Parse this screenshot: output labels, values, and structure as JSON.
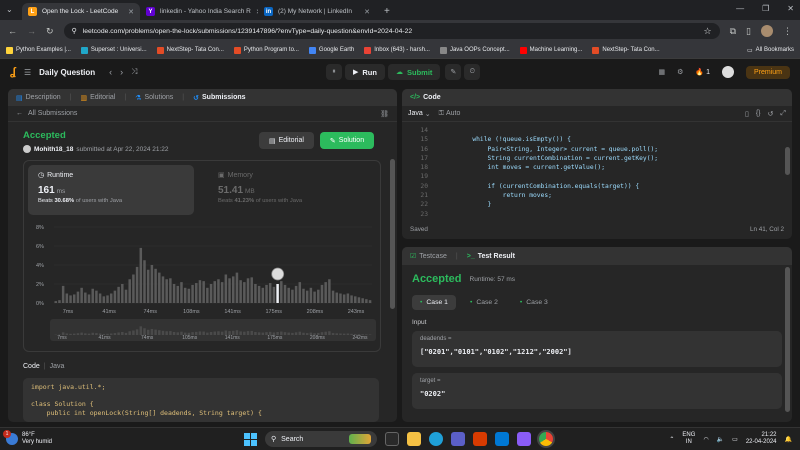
{
  "browser": {
    "tabs": [
      {
        "title": "Open the Lock - LeetCode",
        "active": true,
        "fav_color": "#ffa116",
        "fav_glyph": "L"
      },
      {
        "title": "linkedin - Yahoo India Search R",
        "active": false,
        "fav_color": "#6001d2",
        "fav_glyph": "Y"
      },
      {
        "title": "(2) My Network | LinkedIn",
        "active": false,
        "fav_color": "#0a66c2",
        "fav_glyph": "in"
      }
    ],
    "url": "leetcode.com/problems/open-the-lock/submissions/1239147896/?envType=daily-question&envId=2024-04-22",
    "bookmarks": [
      {
        "label": "Python Examples |...",
        "color": "#ffd43b"
      },
      {
        "label": "Superset : Universi...",
        "color": "#20a7c9"
      },
      {
        "label": "NextStep- Tata Con...",
        "color": "#e34c26"
      },
      {
        "label": "Python Program to...",
        "color": "#e34c26"
      },
      {
        "label": "Google Earth",
        "color": "#4285f4"
      },
      {
        "label": "Inbox (643) - harsh...",
        "color": "#ea4335"
      },
      {
        "label": "Java OOPs Concept...",
        "color": "#888"
      },
      {
        "label": "Machine Learning...",
        "color": "#ff0000"
      },
      {
        "label": "NextStep- Tata Con...",
        "color": "#e34c26"
      }
    ],
    "all_bookmarks": "All Bookmarks"
  },
  "lc": {
    "daily": "Daily Question",
    "run": "Run",
    "submit": "Submit",
    "streak": "1",
    "premium": "Premium"
  },
  "left": {
    "tabs": [
      "Description",
      "Editorial",
      "Solutions",
      "Submissions"
    ],
    "back": "All Submissions",
    "status": "Accepted",
    "user": "Mohith18_18",
    "submitted": "submitted at Apr 22, 2024 21:22",
    "editorial_btn": "Editorial",
    "solution_btn": "Solution",
    "runtime_label": "Runtime",
    "runtime_value": "161",
    "runtime_unit": "ms",
    "runtime_beats": "Beats",
    "runtime_pct": "30.68%",
    "runtime_of": "of users with Java",
    "memory_label": "Memory",
    "memory_value": "51.41",
    "memory_unit": "MB",
    "memory_beats": "Beats",
    "memory_pct": "41.23%",
    "memory_of": "of users with Java",
    "code_label": "Code",
    "code_lang": "Java",
    "code_lines": [
      "import java.util.*;",
      "",
      "class Solution {",
      "    public int openLock(String[] deadends, String target) {"
    ]
  },
  "chart_data": {
    "type": "bar",
    "ylabels": [
      "8%",
      "6%",
      "4%",
      "2%",
      "0%"
    ],
    "ylim": [
      0,
      8
    ],
    "xlabels": [
      "7ms",
      "41ms",
      "74ms",
      "108ms",
      "141ms",
      "175ms",
      "208ms",
      "243ms"
    ],
    "mini_xlabels": [
      "7ms",
      "41ms",
      "74ms",
      "105ms",
      "141ms",
      "175ms",
      "208ms",
      "242ms"
    ],
    "values": [
      0.2,
      0.3,
      1.8,
      1.0,
      0.8,
      0.9,
      1.2,
      1.6,
      1.1,
      0.9,
      1.5,
      1.3,
      1.0,
      0.7,
      0.8,
      1.0,
      1.3,
      1.7,
      2.0,
      1.4,
      2.5,
      3.0,
      3.8,
      5.8,
      4.5,
      3.5,
      4.0,
      3.6,
      3.2,
      2.8,
      2.5,
      2.6,
      2.0,
      1.8,
      2.2,
      1.6,
      1.5,
      1.9,
      2.1,
      2.4,
      2.3,
      1.6,
      2.0,
      2.3,
      2.5,
      2.2,
      3.0,
      2.6,
      2.8,
      3.2,
      2.4,
      2.2,
      2.6,
      2.7,
      2.0,
      1.8,
      1.6,
      1.9,
      2.1,
      1.7,
      2.0,
      2.3,
      1.9,
      1.6,
      1.4,
      1.8,
      2.2,
      1.5,
      1.3,
      1.6,
      1.2,
      1.4,
      1.9,
      2.2,
      2.5,
      1.3,
      1.1,
      1.0,
      0.9,
      1.0,
      0.8,
      0.7,
      0.6,
      0.5,
      0.4,
      0.3
    ],
    "highlight_index": 60,
    "highlight_value": 2.0
  },
  "right": {
    "code_tab": "Code",
    "lang": "Java",
    "auto": "Auto",
    "first_line_num": "13",
    "line_nums": [
      "14",
      "15",
      "16",
      "17",
      "18",
      "19",
      "20",
      "21",
      "22",
      "23"
    ],
    "code": [
      {
        "t": ""
      },
      {
        "t": "        while (!queue.isEmpty()) {"
      },
      {
        "t": "            Pair<String, Integer> current = queue.poll();"
      },
      {
        "t": "            String currentCombination = current.getKey();"
      },
      {
        "t": "            int moves = current.getValue();"
      },
      {
        "t": ""
      },
      {
        "t": "            if (currentCombination.equals(target)) {"
      },
      {
        "t": "                return moves;"
      },
      {
        "t": "            }"
      },
      {
        "t": ""
      }
    ],
    "saved": "Saved",
    "cursor": "Ln 41, Col 2",
    "testcase_tab": "Testcase",
    "result_tab": "Test Result",
    "result_status": "Accepted",
    "result_runtime": "Runtime: 57 ms",
    "cases": [
      "Case 1",
      "Case 2",
      "Case 3"
    ],
    "input_label": "Input",
    "deadends_label": "deadends =",
    "deadends_value": "[\"0201\",\"0101\",\"0102\",\"1212\",\"2002\"]",
    "target_label": "target =",
    "target_value": "\"0202\""
  },
  "taskbar": {
    "badge": "1",
    "temp": "86°F",
    "weather": "Very humid",
    "search": "Search",
    "lang": "ENG",
    "region": "IN",
    "time": "21:22",
    "date": "22-04-2024"
  }
}
